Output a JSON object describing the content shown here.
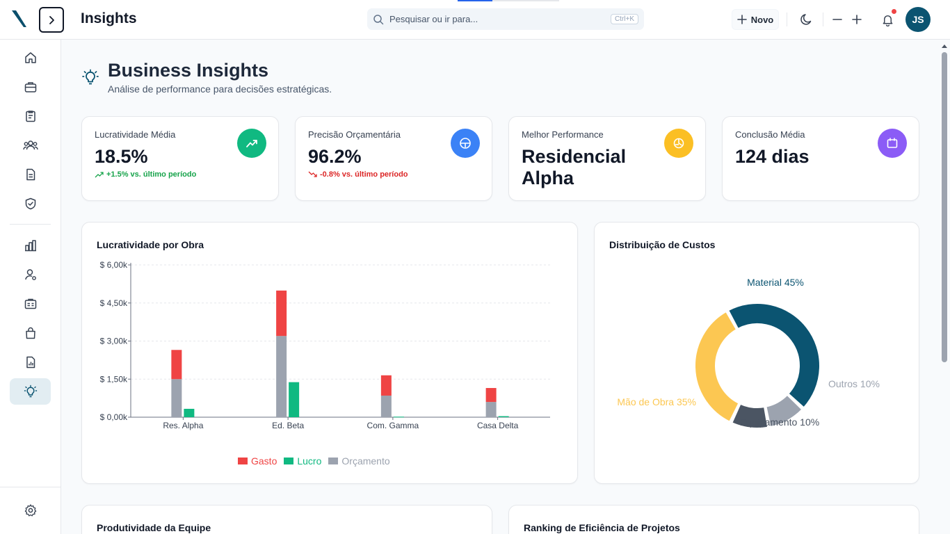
{
  "header": {
    "title": "Insights",
    "search_placeholder": "Pesquisar ou ir para...",
    "search_shortcut": "Ctrl+K",
    "new_label": "Novo",
    "avatar_initials": "JS"
  },
  "page": {
    "title": "Business Insights",
    "subtitle": "Análise de performance para decisões estratégicas."
  },
  "kpis": [
    {
      "label": "Lucratividade Média",
      "value": "18.5%",
      "trend": "+1.5% vs. último período",
      "trend_color": "#16a34a",
      "icon": "trending-up-icon",
      "icon_bg": "#10b981"
    },
    {
      "label": "Precisão Orçamentária",
      "value": "96.2%",
      "trend": "-0.8% vs. último período",
      "trend_color": "#dc2626",
      "icon": "target-icon",
      "icon_bg": "#3b82f6"
    },
    {
      "label": "Melhor Performance",
      "value_line1": "Residencial",
      "value_line2": "Alpha",
      "icon": "pie-chart-icon",
      "icon_bg": "#fbbf24"
    },
    {
      "label": "Conclusão Média",
      "value": "124 dias",
      "icon": "calendar-icon",
      "icon_bg": "#8b5cf6"
    }
  ],
  "profit_chart": {
    "title": "Lucratividade por Obra"
  },
  "cost_chart": {
    "title": "Distribuição de Custos"
  },
  "bottom": {
    "team_title": "Produtividade da Equipe",
    "ranking_title": "Ranking de Eficiência de Projetos"
  },
  "chart_data": [
    {
      "type": "bar",
      "title": "Lucratividade por Obra",
      "categories": [
        "Res. Alpha",
        "Ed. Beta",
        "Com. Gamma",
        "Casa Delta"
      ],
      "y_ticks": [
        "$ 0,00k",
        "$ 1,50k",
        "$ 3,00k",
        "$ 4,50k",
        "$ 6,00k"
      ],
      "ylim": [
        0,
        6000
      ],
      "grid": true,
      "legend_position": "bottom",
      "series": [
        {
          "name": "Gasto",
          "color": "#ef4444",
          "values": [
            2650,
            4990,
            1650,
            1150
          ]
        },
        {
          "name": "Lucro",
          "color": "#10b981",
          "values": [
            330,
            1380,
            20,
            40
          ]
        },
        {
          "name": "Orçamento",
          "color": "#9ca3af",
          "values": [
            1500,
            3200,
            850,
            600
          ]
        }
      ]
    },
    {
      "type": "pie",
      "title": "Distribuição de Custos",
      "slices": [
        {
          "label": "Material 45%",
          "value": 45,
          "color": "#0b5471"
        },
        {
          "label": "Outros 10%",
          "value": 10,
          "color": "#9ca3af"
        },
        {
          "label": "Equipamento 10%",
          "value": 10,
          "color": "#4b5563"
        },
        {
          "label": "Mão de Obra 35%",
          "value": 35,
          "color": "#fcc752"
        }
      ]
    }
  ]
}
